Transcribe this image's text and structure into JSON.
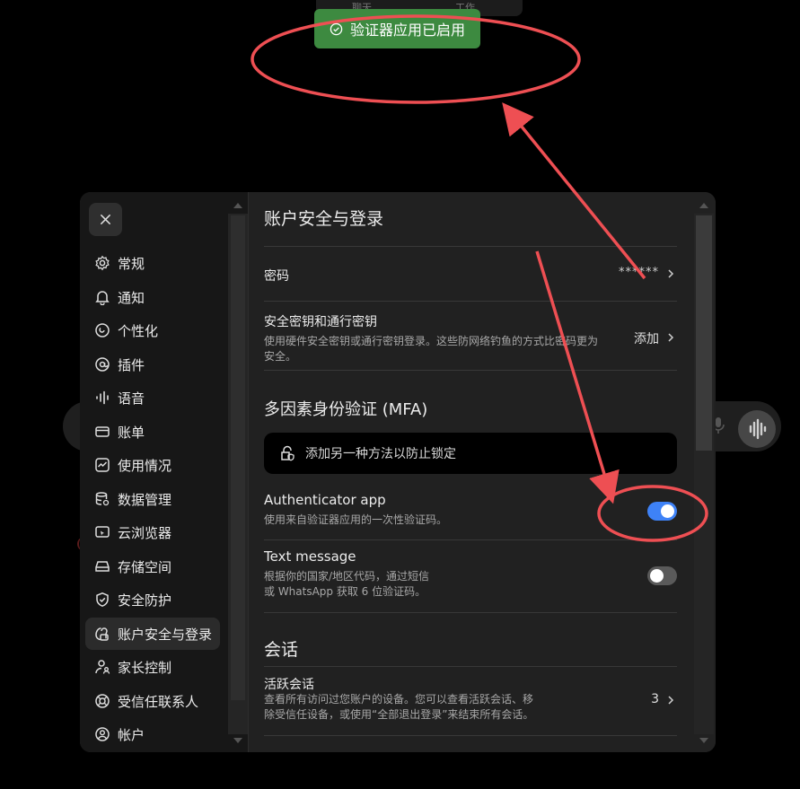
{
  "toast": {
    "text": "验证器应用已启用"
  },
  "top_tabs": [
    "聊天",
    "工作"
  ],
  "sidebar": {
    "items": [
      {
        "label": "常规",
        "icon": "gear-icon"
      },
      {
        "label": "通知",
        "icon": "bell-icon"
      },
      {
        "label": "个性化",
        "icon": "personalize-icon"
      },
      {
        "label": "插件",
        "icon": "plugin-icon"
      },
      {
        "label": "语音",
        "icon": "voice-wave-icon"
      },
      {
        "label": "账单",
        "icon": "card-icon"
      },
      {
        "label": "使用情况",
        "icon": "usage-chart-icon"
      },
      {
        "label": "数据管理",
        "icon": "database-icon"
      },
      {
        "label": "云浏览器",
        "icon": "cloud-browser-icon"
      },
      {
        "label": "存储空间",
        "icon": "storage-icon"
      },
      {
        "label": "安全防护",
        "icon": "shield-icon"
      },
      {
        "label": "账户安全与登录",
        "icon": "key-lock-icon",
        "active": true
      },
      {
        "label": "家长控制",
        "icon": "parental-icon"
      },
      {
        "label": "受信任联系人",
        "icon": "lifebuoy-icon"
      },
      {
        "label": "帐户",
        "icon": "account-icon"
      }
    ]
  },
  "content": {
    "title": "账户安全与登录",
    "password": {
      "label": "密码",
      "value": "******"
    },
    "passkey": {
      "label": "安全密钥和通行密钥",
      "desc1": "使用硬件安全密钥或通行密钥登录。这些防网络钓鱼的方式比密码更为",
      "desc2": "安全。",
      "action": "添加"
    },
    "mfa": {
      "heading": "多因素身份验证 (MFA)",
      "banner": "添加另一种方法以防止锁定",
      "authenticator": {
        "label": "Authenticator app",
        "desc": "使用来自验证器应用的一次性验证码。",
        "enabled": true
      },
      "sms": {
        "label": "Text message",
        "desc1": "根据你的国家/地区代码，通过短信",
        "desc2": "或 WhatsApp 获取 6 位验证码。",
        "enabled": false
      }
    },
    "sessions": {
      "heading": "会话",
      "active": {
        "label": "活跃会话",
        "desc1": "查看所有访问过您账户的设备。您可以查看活跃会话、移",
        "desc2": "除受信任设备，或使用“全部退出登录”来结束所有会话。",
        "count": "3"
      }
    }
  },
  "colors": {
    "toggle_on": "#3e82f7",
    "toggle_off": "#5a5a5a",
    "toast_bg": "#3d8a40",
    "annotation": "#ee4f53"
  }
}
